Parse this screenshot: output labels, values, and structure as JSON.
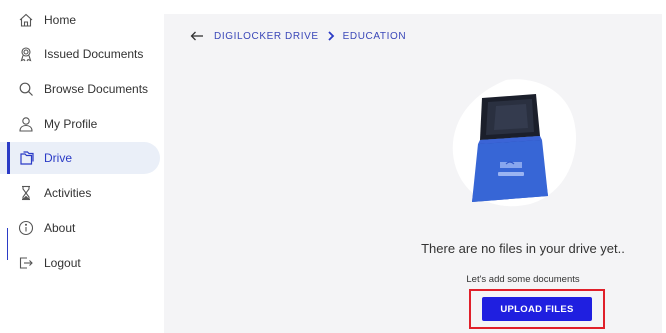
{
  "sidebar": {
    "items": [
      {
        "label": "Home",
        "icon": "home-icon"
      },
      {
        "label": "Issued Documents",
        "icon": "award-icon"
      },
      {
        "label": "Browse Documents",
        "icon": "search-icon"
      },
      {
        "label": "My Profile",
        "icon": "user-icon"
      },
      {
        "label": "Drive",
        "icon": "folders-icon",
        "active": true
      },
      {
        "label": "Activities",
        "icon": "hourglass-icon"
      },
      {
        "label": "About",
        "icon": "info-icon"
      },
      {
        "label": "Logout",
        "icon": "logout-icon"
      }
    ]
  },
  "breadcrumb": {
    "root": "DIGILOCKER DRIVE",
    "current": "EDUCATION"
  },
  "empty_state": {
    "title": "There are no files in your drive yet..",
    "subtitle": "Let's add some documents",
    "upload_label": "UPLOAD FILES"
  },
  "colors": {
    "accent": "#2b3bc6",
    "button": "#1f1fe0",
    "highlight": "#e0202a",
    "active_bg": "#eaeff8",
    "main_bg": "#f4f4f6"
  }
}
